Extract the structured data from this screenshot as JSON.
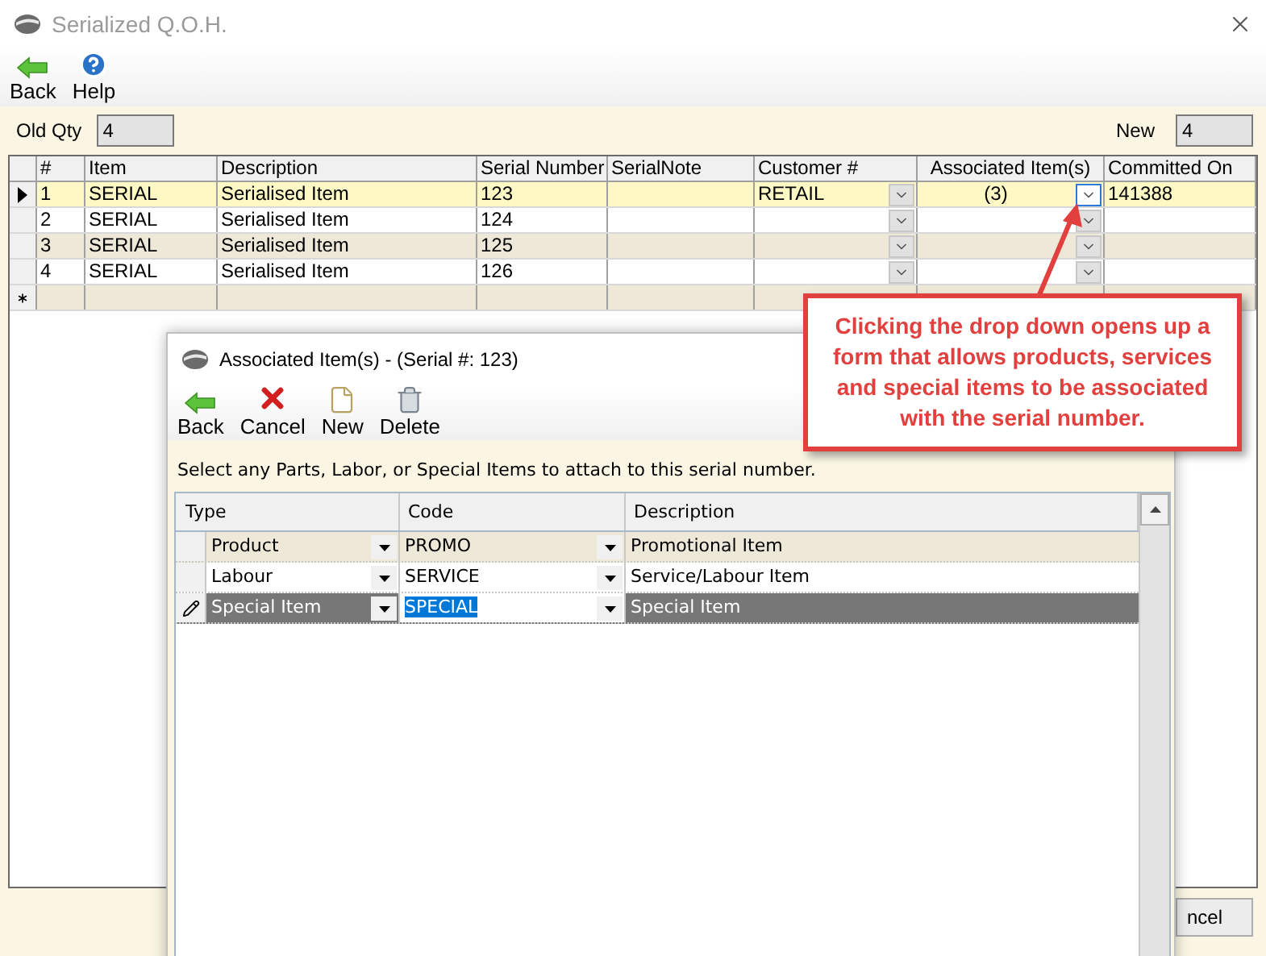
{
  "window": {
    "title": "Serialized Q.O.H."
  },
  "toolbar": [
    {
      "label": "Back",
      "kind": "back"
    },
    {
      "label": "Help",
      "kind": "help"
    }
  ],
  "old_qty": {
    "label": "Old Qty",
    "value": "4"
  },
  "new_qty": {
    "label": "New",
    "value": "4"
  },
  "table": {
    "columns": [
      "#",
      "Item",
      "Description",
      "Serial Number",
      "SerialNote",
      "Customer #",
      "Associated Item(s)",
      "Committed On"
    ],
    "rows": [
      {
        "number": "1",
        "item": "SERIAL",
        "description": "Serialised Item",
        "serial_number": "123",
        "customer": "RETAIL",
        "associated_items": "(3)",
        "committed_on": "141388",
        "selected": true
      },
      {
        "number": "2",
        "item": "SERIAL",
        "description": "Serialised Item",
        "serial_number": "124",
        "selected": false
      },
      {
        "number": "3",
        "item": "SERIAL",
        "description": "Serialised Item",
        "serial_number": "125",
        "selected": false
      },
      {
        "number": "4",
        "item": "SERIAL",
        "description": "Serialised Item",
        "serial_number": "126",
        "selected": false
      }
    ]
  },
  "cancel_button": "ncel",
  "dialog": {
    "title": "Associated Item(s) - (Serial #: 123)",
    "toolbar": [
      {
        "label": "Back",
        "kind": "back"
      },
      {
        "label": "Cancel",
        "kind": "cancel"
      },
      {
        "label": "New",
        "kind": "new"
      },
      {
        "label": "Delete",
        "kind": "delete"
      }
    ],
    "instruction": "Select any Parts, Labor, or Special Items to attach to this serial number.",
    "table": {
      "columns": [
        "Type",
        "Code",
        "Description"
      ],
      "rows": [
        {
          "type": "Product",
          "code": "PROMO",
          "description": "Promotional Item",
          "selected": false
        },
        {
          "type": "Labour",
          "code": "SERVICE",
          "description": "Service/Labour Item",
          "selected": false
        },
        {
          "type": "Special Item",
          "code": "SPECIAL",
          "description": "Special Item",
          "selected": true
        }
      ]
    }
  },
  "callout": {
    "text": "Clicking the drop down opens up a form that allows products, services and special items to be associated with the serial number."
  }
}
